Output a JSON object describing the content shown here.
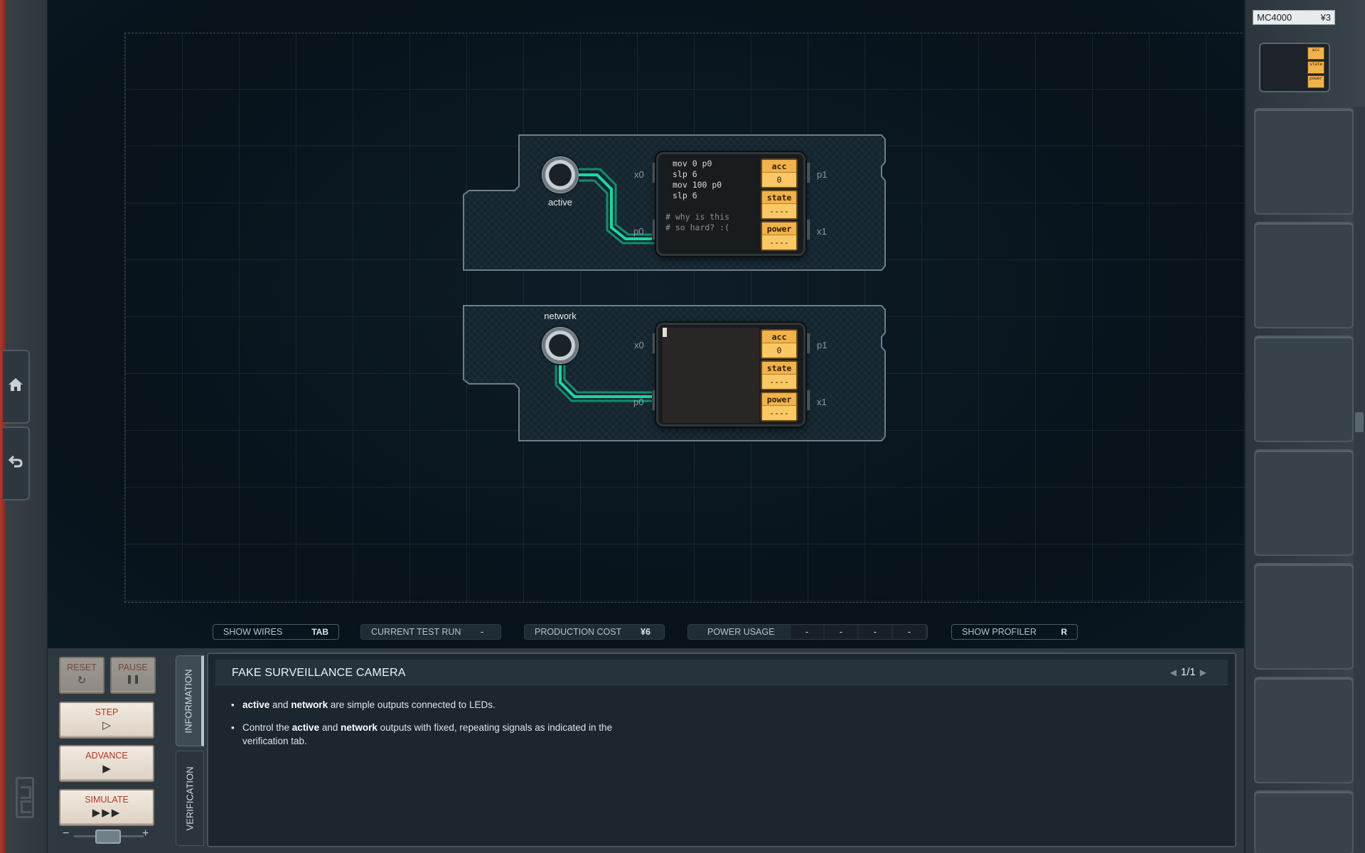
{
  "board": {
    "module1": {
      "led_label": "active",
      "pins": {
        "x0": "x0",
        "p0": "p0",
        "p1": "p1",
        "x1": "x1"
      },
      "code_lines": [
        "mov 0 p0",
        "slp 6",
        "mov 100 p0",
        "slp 6",
        "",
        "# why is this",
        "# so hard? :("
      ],
      "registers": {
        "acc_name": "acc",
        "acc_val": "0",
        "state_name": "state",
        "state_val": "----",
        "power_name": "power",
        "power_val": "----"
      }
    },
    "module2": {
      "led_label": "network",
      "pins": {
        "x0": "x0",
        "p0": "p0",
        "p1": "p1",
        "x1": "x1"
      },
      "code_lines": [],
      "registers": {
        "acc_name": "acc",
        "acc_val": "0",
        "state_name": "state",
        "state_val": "----",
        "power_name": "power",
        "power_val": "----"
      }
    }
  },
  "status_bar": {
    "show_wires": {
      "label": "SHOW WIRES",
      "key": "TAB"
    },
    "current_test_run": {
      "label": "CURRENT TEST RUN",
      "value": "-"
    },
    "production_cost": {
      "label": "PRODUCTION COST",
      "value": "¥6"
    },
    "power_usage": {
      "label": "POWER USAGE",
      "values": [
        "-",
        "-",
        "-",
        "-"
      ]
    },
    "show_profiler": {
      "label": "SHOW PROFILER",
      "key": "R"
    }
  },
  "controls": {
    "reset": {
      "label": "RESET",
      "icon": "reset-icon",
      "glyph": "↻"
    },
    "pause": {
      "label": "PAUSE",
      "icon": "pause-icon",
      "glyph": "❚❚"
    },
    "step": {
      "label": "STEP",
      "icon": "play-outline-icon",
      "glyph": "▷"
    },
    "advance": {
      "label": "ADVANCE",
      "icon": "play-icon",
      "glyph": "▶"
    },
    "simulate": {
      "label": "SIMULATE",
      "icon": "fast-forward-icon",
      "glyph": "▶▶▶"
    },
    "speed_minus": "−",
    "speed_plus": "+"
  },
  "tabs": {
    "information": "INFORMATION",
    "verification": "VERIFICATION"
  },
  "info": {
    "title": "FAKE SURVEILLANCE CAMERA",
    "pager": "1/1",
    "bullet1": {
      "b1": "active",
      "t1": " and ",
      "b2": "network",
      "t2": " are simple outputs connected to LEDs."
    },
    "bullet2": {
      "t0": "Control the ",
      "b1": "active",
      "t1": " and ",
      "b2": "network",
      "t2": " outputs with fixed, repeating signals as indicated in the verification tab."
    }
  },
  "store": {
    "item_name": "MC4000",
    "item_price": "¥3",
    "mini_regs": [
      "acc",
      "state",
      "power"
    ]
  },
  "colors": {
    "register": "#f2b24a",
    "wire": "#1fd6a0",
    "accent_red": "#b13a22"
  }
}
